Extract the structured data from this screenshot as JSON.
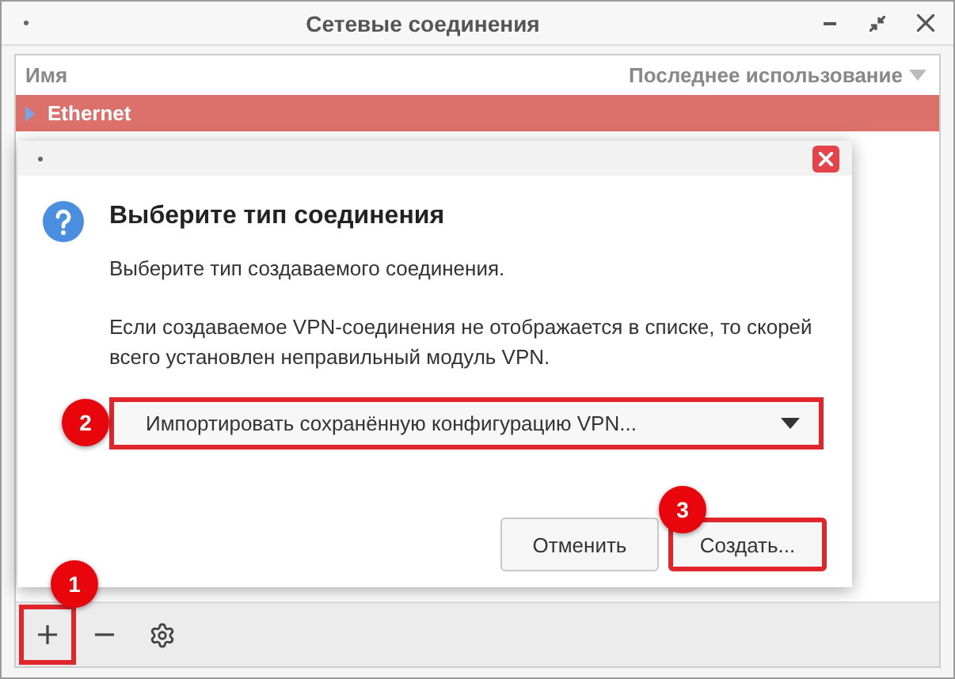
{
  "window": {
    "title": "Сетевые соединения"
  },
  "list": {
    "columns": [
      "Имя",
      "Последнее использование"
    ],
    "rows": [
      {
        "name": "Ethernet",
        "selected": true,
        "expanded": false
      }
    ]
  },
  "toolbar": [
    {
      "kind": "add",
      "highlighted": true,
      "badge": "1"
    },
    {
      "kind": "remove",
      "highlighted": false
    },
    {
      "kind": "settings",
      "highlighted": false
    }
  ],
  "dialog": {
    "heading": "Выберите тип соединения",
    "description": "Выберите тип создаваемого соединения.",
    "note": "Если создаваемое VPN-соединения не отображается в списке, то скорей всего установлен неправильный модуль VPN.",
    "dropdown": {
      "value": "Импортировать сохранённую конфигурацию VPN...",
      "highlighted": true,
      "badge": "2"
    },
    "buttons": [
      {
        "label": "Отменить",
        "highlighted": false
      },
      {
        "label": "Создать...",
        "highlighted": true,
        "badge": "3"
      }
    ]
  }
}
